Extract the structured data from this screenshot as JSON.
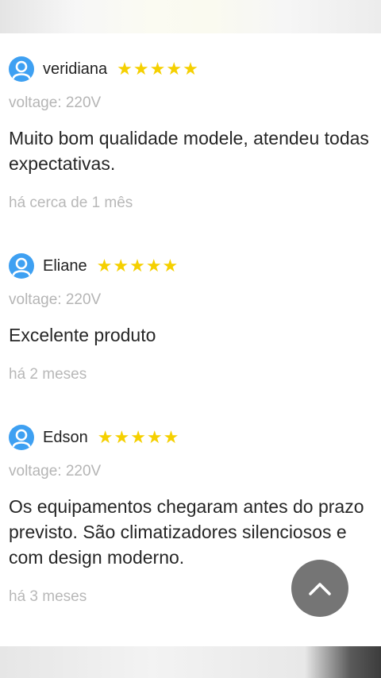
{
  "reviews": [
    {
      "name": "veridiana",
      "rating": 5,
      "variant": "voltage: 220V",
      "comment": "Muito bom qualidade modele, atendeu todas expectativas.",
      "date": "há cerca de 1 mês"
    },
    {
      "name": "Eliane",
      "rating": 5,
      "variant": "voltage: 220V",
      "comment": "Excelente produto",
      "date": "há 2 meses"
    },
    {
      "name": "Edson",
      "rating": 5,
      "variant": "voltage: 220V",
      "comment": "Os equipamentos chegaram antes do prazo previsto. São climatizadores silenciosos e com design moderno.",
      "date": "há 3 meses"
    }
  ],
  "icons": {
    "avatar": "user-avatar-icon",
    "star": "star-icon",
    "back_to_top": "chevron-up-icon"
  },
  "colors": {
    "avatar": "#3ea0f2",
    "star": "#f5d000",
    "muted_text": "#b5b5b5",
    "back_to_top_bg": "#696969"
  }
}
